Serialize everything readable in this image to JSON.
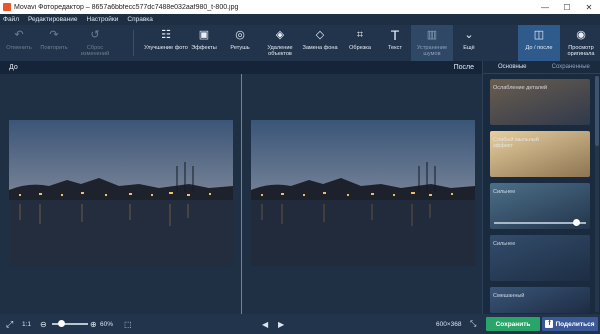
{
  "window": {
    "title": "Movavi Фоторедактор – 8657a6bbfecc577dc7488e032aaf980_t-800.jpg",
    "minimize": "—",
    "maximize": "☐",
    "close": "✕"
  },
  "menu": [
    "Файл",
    "Редактирование",
    "Настройки",
    "Справка"
  ],
  "toolbar": {
    "undo": "Отменить",
    "redo": "Повторить",
    "reset": "Сброс изменений",
    "enhance": "Улучшение фото",
    "effects": "Эффекты",
    "retouch": "Ретушь",
    "remove_objects": "Удаление объектов",
    "replace_bg": "Замена фона",
    "crop": "Обрезка",
    "text": "Текст",
    "remove_noise": "Устранение шумов",
    "more": "Ещё",
    "before_after": "До / после",
    "preview_original": "Просмотр оригинала"
  },
  "view": {
    "before_label": "До",
    "after_label": "После"
  },
  "panel": {
    "tabs": [
      "Основные",
      "Сохраненные"
    ],
    "cards": [
      {
        "label": "Ослабление деталей",
        "color_top": "#6b5d4e",
        "color_bottom": "#2f3a4c"
      },
      {
        "label": "Слабый мыльный эффект",
        "color_top": "#e7cfa0",
        "color_bottom": "#8e7451"
      },
      {
        "label": "Сильнее",
        "color_top": "#4c6f88",
        "color_bottom": "#23364d",
        "slider": 0.9
      },
      {
        "label": "Сильнее",
        "color_top": "#334d6b",
        "color_bottom": "#1d2d44"
      },
      {
        "label": "Смешанный",
        "color_top": "#3a5678",
        "color_bottom": "#1d2c44"
      }
    ]
  },
  "statusbar": {
    "fit_label": "1:1",
    "zoom_value": "60%",
    "zoom_fraction": 0.25,
    "image_size": "600×368",
    "save": "Сохранить",
    "share": "Поделиться",
    "share_icon": "f"
  }
}
